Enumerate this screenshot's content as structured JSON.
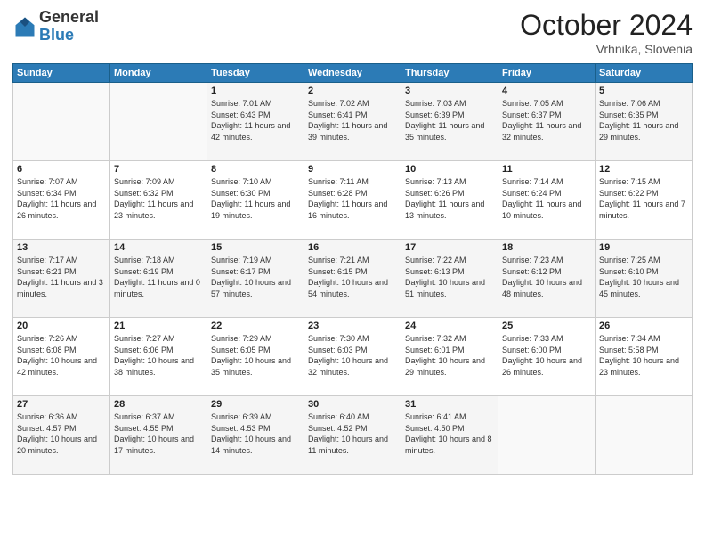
{
  "header": {
    "logo_general": "General",
    "logo_blue": "Blue",
    "month": "October 2024",
    "location": "Vrhnika, Slovenia"
  },
  "weekdays": [
    "Sunday",
    "Monday",
    "Tuesday",
    "Wednesday",
    "Thursday",
    "Friday",
    "Saturday"
  ],
  "weeks": [
    [
      {
        "day": "",
        "sunrise": "",
        "sunset": "",
        "daylight": ""
      },
      {
        "day": "",
        "sunrise": "",
        "sunset": "",
        "daylight": ""
      },
      {
        "day": "1",
        "sunrise": "Sunrise: 7:01 AM",
        "sunset": "Sunset: 6:43 PM",
        "daylight": "Daylight: 11 hours and 42 minutes."
      },
      {
        "day": "2",
        "sunrise": "Sunrise: 7:02 AM",
        "sunset": "Sunset: 6:41 PM",
        "daylight": "Daylight: 11 hours and 39 minutes."
      },
      {
        "day": "3",
        "sunrise": "Sunrise: 7:03 AM",
        "sunset": "Sunset: 6:39 PM",
        "daylight": "Daylight: 11 hours and 35 minutes."
      },
      {
        "day": "4",
        "sunrise": "Sunrise: 7:05 AM",
        "sunset": "Sunset: 6:37 PM",
        "daylight": "Daylight: 11 hours and 32 minutes."
      },
      {
        "day": "5",
        "sunrise": "Sunrise: 7:06 AM",
        "sunset": "Sunset: 6:35 PM",
        "daylight": "Daylight: 11 hours and 29 minutes."
      }
    ],
    [
      {
        "day": "6",
        "sunrise": "Sunrise: 7:07 AM",
        "sunset": "Sunset: 6:34 PM",
        "daylight": "Daylight: 11 hours and 26 minutes."
      },
      {
        "day": "7",
        "sunrise": "Sunrise: 7:09 AM",
        "sunset": "Sunset: 6:32 PM",
        "daylight": "Daylight: 11 hours and 23 minutes."
      },
      {
        "day": "8",
        "sunrise": "Sunrise: 7:10 AM",
        "sunset": "Sunset: 6:30 PM",
        "daylight": "Daylight: 11 hours and 19 minutes."
      },
      {
        "day": "9",
        "sunrise": "Sunrise: 7:11 AM",
        "sunset": "Sunset: 6:28 PM",
        "daylight": "Daylight: 11 hours and 16 minutes."
      },
      {
        "day": "10",
        "sunrise": "Sunrise: 7:13 AM",
        "sunset": "Sunset: 6:26 PM",
        "daylight": "Daylight: 11 hours and 13 minutes."
      },
      {
        "day": "11",
        "sunrise": "Sunrise: 7:14 AM",
        "sunset": "Sunset: 6:24 PM",
        "daylight": "Daylight: 11 hours and 10 minutes."
      },
      {
        "day": "12",
        "sunrise": "Sunrise: 7:15 AM",
        "sunset": "Sunset: 6:22 PM",
        "daylight": "Daylight: 11 hours and 7 minutes."
      }
    ],
    [
      {
        "day": "13",
        "sunrise": "Sunrise: 7:17 AM",
        "sunset": "Sunset: 6:21 PM",
        "daylight": "Daylight: 11 hours and 3 minutes."
      },
      {
        "day": "14",
        "sunrise": "Sunrise: 7:18 AM",
        "sunset": "Sunset: 6:19 PM",
        "daylight": "Daylight: 11 hours and 0 minutes."
      },
      {
        "day": "15",
        "sunrise": "Sunrise: 7:19 AM",
        "sunset": "Sunset: 6:17 PM",
        "daylight": "Daylight: 10 hours and 57 minutes."
      },
      {
        "day": "16",
        "sunrise": "Sunrise: 7:21 AM",
        "sunset": "Sunset: 6:15 PM",
        "daylight": "Daylight: 10 hours and 54 minutes."
      },
      {
        "day": "17",
        "sunrise": "Sunrise: 7:22 AM",
        "sunset": "Sunset: 6:13 PM",
        "daylight": "Daylight: 10 hours and 51 minutes."
      },
      {
        "day": "18",
        "sunrise": "Sunrise: 7:23 AM",
        "sunset": "Sunset: 6:12 PM",
        "daylight": "Daylight: 10 hours and 48 minutes."
      },
      {
        "day": "19",
        "sunrise": "Sunrise: 7:25 AM",
        "sunset": "Sunset: 6:10 PM",
        "daylight": "Daylight: 10 hours and 45 minutes."
      }
    ],
    [
      {
        "day": "20",
        "sunrise": "Sunrise: 7:26 AM",
        "sunset": "Sunset: 6:08 PM",
        "daylight": "Daylight: 10 hours and 42 minutes."
      },
      {
        "day": "21",
        "sunrise": "Sunrise: 7:27 AM",
        "sunset": "Sunset: 6:06 PM",
        "daylight": "Daylight: 10 hours and 38 minutes."
      },
      {
        "day": "22",
        "sunrise": "Sunrise: 7:29 AM",
        "sunset": "Sunset: 6:05 PM",
        "daylight": "Daylight: 10 hours and 35 minutes."
      },
      {
        "day": "23",
        "sunrise": "Sunrise: 7:30 AM",
        "sunset": "Sunset: 6:03 PM",
        "daylight": "Daylight: 10 hours and 32 minutes."
      },
      {
        "day": "24",
        "sunrise": "Sunrise: 7:32 AM",
        "sunset": "Sunset: 6:01 PM",
        "daylight": "Daylight: 10 hours and 29 minutes."
      },
      {
        "day": "25",
        "sunrise": "Sunrise: 7:33 AM",
        "sunset": "Sunset: 6:00 PM",
        "daylight": "Daylight: 10 hours and 26 minutes."
      },
      {
        "day": "26",
        "sunrise": "Sunrise: 7:34 AM",
        "sunset": "Sunset: 5:58 PM",
        "daylight": "Daylight: 10 hours and 23 minutes."
      }
    ],
    [
      {
        "day": "27",
        "sunrise": "Sunrise: 6:36 AM",
        "sunset": "Sunset: 4:57 PM",
        "daylight": "Daylight: 10 hours and 20 minutes."
      },
      {
        "day": "28",
        "sunrise": "Sunrise: 6:37 AM",
        "sunset": "Sunset: 4:55 PM",
        "daylight": "Daylight: 10 hours and 17 minutes."
      },
      {
        "day": "29",
        "sunrise": "Sunrise: 6:39 AM",
        "sunset": "Sunset: 4:53 PM",
        "daylight": "Daylight: 10 hours and 14 minutes."
      },
      {
        "day": "30",
        "sunrise": "Sunrise: 6:40 AM",
        "sunset": "Sunset: 4:52 PM",
        "daylight": "Daylight: 10 hours and 11 minutes."
      },
      {
        "day": "31",
        "sunrise": "Sunrise: 6:41 AM",
        "sunset": "Sunset: 4:50 PM",
        "daylight": "Daylight: 10 hours and 8 minutes."
      },
      {
        "day": "",
        "sunrise": "",
        "sunset": "",
        "daylight": ""
      },
      {
        "day": "",
        "sunrise": "",
        "sunset": "",
        "daylight": ""
      }
    ]
  ]
}
